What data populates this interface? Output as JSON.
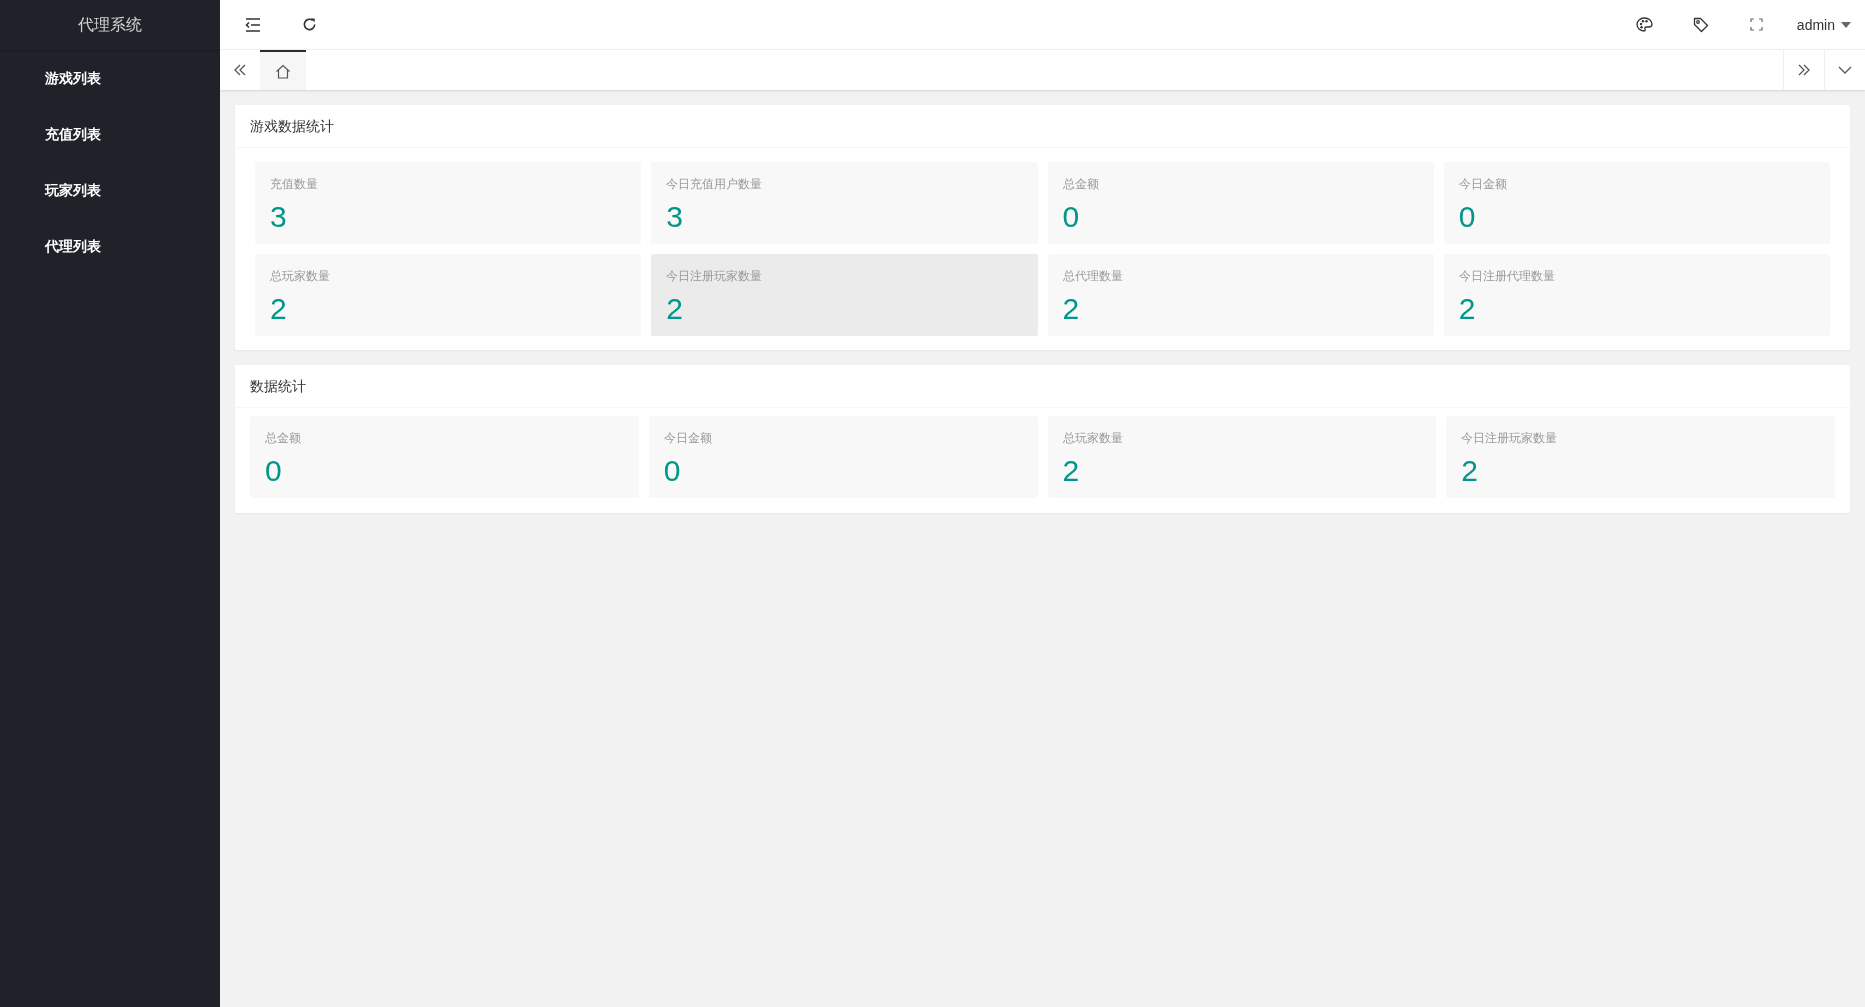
{
  "sidebar": {
    "logo": "代理系统",
    "items": [
      {
        "label": "游戏列表"
      },
      {
        "label": "充值列表"
      },
      {
        "label": "玩家列表"
      },
      {
        "label": "代理列表"
      }
    ]
  },
  "header": {
    "user": "admin"
  },
  "tabs": [
    {
      "kind": "home",
      "selected": true
    }
  ],
  "panels": [
    {
      "title": "游戏数据统计",
      "stats": [
        {
          "label": "充值数量",
          "value": "3",
          "hovered": false
        },
        {
          "label": "今日充值用户数量",
          "value": "3",
          "hovered": false
        },
        {
          "label": "总金额",
          "value": "0",
          "hovered": false
        },
        {
          "label": "今日金额",
          "value": "0",
          "hovered": false
        },
        {
          "label": "总玩家数量",
          "value": "2",
          "hovered": false
        },
        {
          "label": "今日注册玩家数量",
          "value": "2",
          "hovered": true
        },
        {
          "label": "总代理数量",
          "value": "2",
          "hovered": false
        },
        {
          "label": "今日注册代理数量",
          "value": "2",
          "hovered": false
        }
      ]
    },
    {
      "title": "数据统计",
      "stats": [
        {
          "label": "总金额",
          "value": "0",
          "hovered": false
        },
        {
          "label": "今日金额",
          "value": "0",
          "hovered": false
        },
        {
          "label": "总玩家数量",
          "value": "2",
          "hovered": false
        },
        {
          "label": "今日注册玩家数量",
          "value": "2",
          "hovered": false
        }
      ]
    }
  ]
}
